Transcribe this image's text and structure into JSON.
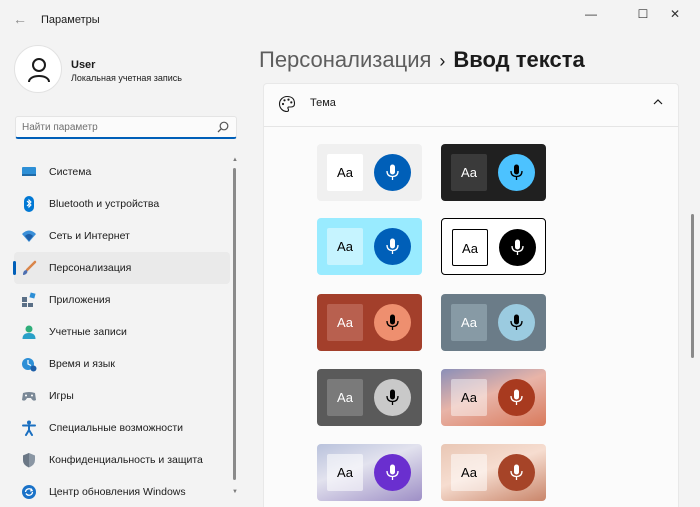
{
  "window": {
    "title": "Параметры",
    "back_glyph": "←",
    "minimize_glyph": "—",
    "maximize_glyph": "☐",
    "close_glyph": "✕"
  },
  "user": {
    "name": "User",
    "account_type": "Локальная учетная запись"
  },
  "search": {
    "placeholder": "Найти параметр",
    "value": ""
  },
  "sidebar": {
    "items": [
      {
        "label": "Система",
        "icon": "system-icon",
        "active": false
      },
      {
        "label": "Bluetooth и устройства",
        "icon": "bluetooth-icon",
        "active": false
      },
      {
        "label": "Сеть и Интернет",
        "icon": "wifi-icon",
        "active": false
      },
      {
        "label": "Персонализация",
        "icon": "brush-icon",
        "active": true
      },
      {
        "label": "Приложения",
        "icon": "apps-icon",
        "active": false
      },
      {
        "label": "Учетные записи",
        "icon": "accounts-icon",
        "active": false
      },
      {
        "label": "Время и язык",
        "icon": "time-language-icon",
        "active": false
      },
      {
        "label": "Игры",
        "icon": "gamepad-icon",
        "active": false
      },
      {
        "label": "Специальные возможности",
        "icon": "accessibility-icon",
        "active": false
      },
      {
        "label": "Конфиденциальность и защита",
        "icon": "shield-icon",
        "active": false
      },
      {
        "label": "Центр обновления Windows",
        "icon": "update-icon",
        "active": false
      }
    ]
  },
  "breadcrumb": {
    "parent": "Персонализация",
    "separator": "›",
    "current": "Ввод текста"
  },
  "theme_section": {
    "label": "Тема",
    "expanded": true
  },
  "themes": [
    {
      "sample": "Aa",
      "bg": "#f0f0f0",
      "text_bg": "#ffffff",
      "text_color": "#000000",
      "mic_bg": "#005fb8",
      "mic_color": "#ffffff",
      "border": "none"
    },
    {
      "sample": "Aa",
      "bg": "#202020",
      "text_bg": "#3a3a3a",
      "text_color": "#ffffff",
      "mic_bg": "#4cc2ff",
      "mic_color": "#000000",
      "border": "none"
    },
    {
      "sample": "Aa",
      "bg": "#99ebff",
      "text_bg": "#c6f4ff",
      "text_color": "#000000",
      "mic_bg": "#005fb8",
      "mic_color": "#ffffff",
      "border": "none"
    },
    {
      "sample": "Aa",
      "bg": "#ffffff",
      "text_bg": "#ffffff",
      "text_color": "#000000",
      "mic_bg": "#000000",
      "mic_color": "#ffffff",
      "border": "#000000"
    },
    {
      "sample": "Aa",
      "bg": "#a33f2b",
      "text_bg": "#b8604f",
      "text_color": "#ffffff",
      "mic_bg": "#ee8f6f",
      "mic_color": "#000000",
      "border": "none"
    },
    {
      "sample": "Aa",
      "bg": "#6b7c88",
      "text_bg": "#879aa5",
      "text_color": "#ffffff",
      "mic_bg": "#9bcbe0",
      "mic_color": "#000000",
      "border": "none"
    },
    {
      "sample": "Aa",
      "bg": "#5a5a5a",
      "text_bg": "#7a7a7a",
      "text_color": "#ffffff",
      "mic_bg": "#c9c9c9",
      "mic_color": "#000000",
      "border": "none"
    },
    {
      "sample": "Aa",
      "bg": "linear-gradient(160deg,#8b8fb8 0%,#e8b4a8 45%,#d97a5c 100%)",
      "text_bg": "rgba(255,255,255,0.45)",
      "text_color": "#000000",
      "mic_bg": "#a83a1f",
      "mic_color": "#ffffff",
      "border": "none"
    },
    {
      "sample": "Aa",
      "bg": "linear-gradient(160deg,#b9c2dc 0%,#e2e2ee 40%,#9e8fc6 100%)",
      "text_bg": "rgba(255,255,255,0.55)",
      "text_color": "#000000",
      "mic_bg": "#6a2fcf",
      "mic_color": "#ffffff",
      "border": "none"
    },
    {
      "sample": "Aa",
      "bg": "linear-gradient(160deg,#e9c7b5 0%,#f6ddd0 45%,#c9856a 100%)",
      "text_bg": "rgba(255,255,255,0.5)",
      "text_color": "#000000",
      "mic_bg": "#a64428",
      "mic_color": "#ffffff",
      "border": "none"
    }
  ],
  "colors": {
    "accent": "#005fb8"
  }
}
